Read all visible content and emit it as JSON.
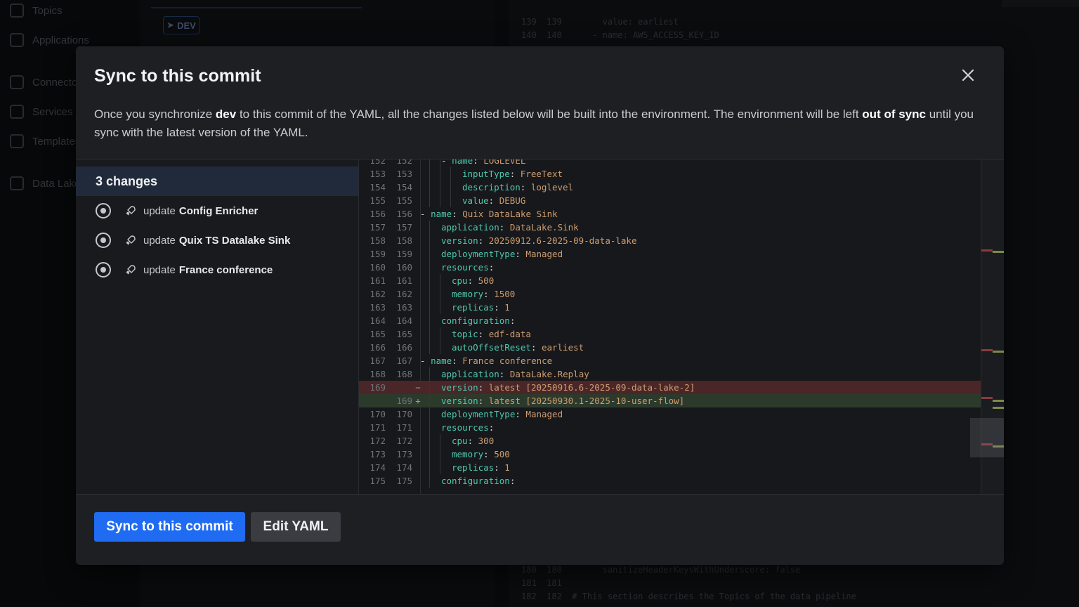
{
  "background": {
    "nav": [
      {
        "label": "Topics",
        "icon": "arrows-icon"
      },
      {
        "label": "Applications",
        "icon": "code-icon"
      },
      {
        "label": "Connectors",
        "icon": "plug-icon"
      },
      {
        "label": "Services",
        "icon": "cube-icon"
      },
      {
        "label": "Templates",
        "icon": "template-icon"
      },
      {
        "label": "Data Lake",
        "icon": "database-icon"
      }
    ],
    "dev_badge": "DEV",
    "code_rows": [
      "139  139        value: earliest",
      "140  140      - name: AWS_ACCESS_KEY_ID",
      "180  180        sanitizeHeaderKeysWithUnderscore: false",
      "181  181",
      "182  182  # This section describes the Topics of the data pipeline"
    ]
  },
  "modal": {
    "title": "Sync to this commit",
    "description": {
      "p1": "Once you synchronize ",
      "env": "dev",
      "p2": " to this commit of the YAML, all the changes listed below will be built into the environment. The environment will be left ",
      "status": "out of sync",
      "p3": " until you sync with the latest version of the YAML."
    },
    "changes_header": "3 changes",
    "changes": [
      {
        "prefix": "update",
        "name": "Config Enricher"
      },
      {
        "prefix": "update",
        "name": "Quix TS Datalake Sink"
      },
      {
        "prefix": "update",
        "name": "France conference"
      }
    ],
    "sync_button": "Sync to this commit",
    "edit_button": "Edit YAML"
  },
  "diff": [
    {
      "a": "152",
      "b": "152",
      "indent": 2,
      "dash": true,
      "key": "name",
      "val": "LOGLEVEL",
      "type": "ctx"
    },
    {
      "a": "153",
      "b": "153",
      "indent": 3,
      "key": "inputType",
      "val": "FreeText",
      "type": "ctx"
    },
    {
      "a": "154",
      "b": "154",
      "indent": 3,
      "key": "description",
      "val": "loglevel",
      "type": "ctx"
    },
    {
      "a": "155",
      "b": "155",
      "indent": 3,
      "key": "value",
      "val": "DEBUG",
      "type": "ctx"
    },
    {
      "a": "156",
      "b": "156",
      "indent": 0,
      "dash": true,
      "key": "name",
      "val": "Quix DataLake Sink",
      "type": "ctx"
    },
    {
      "a": "157",
      "b": "157",
      "indent": 1,
      "key": "application",
      "val": "DataLake.Sink",
      "type": "ctx"
    },
    {
      "a": "158",
      "b": "158",
      "indent": 1,
      "key": "version",
      "val": "20250912.6-2025-09-data-lake",
      "type": "ctx"
    },
    {
      "a": "159",
      "b": "159",
      "indent": 1,
      "key": "deploymentType",
      "val": "Managed",
      "type": "ctx"
    },
    {
      "a": "160",
      "b": "160",
      "indent": 1,
      "key": "resources",
      "val": "",
      "type": "ctx"
    },
    {
      "a": "161",
      "b": "161",
      "indent": 2,
      "key": "cpu",
      "val": "500",
      "type": "ctx"
    },
    {
      "a": "162",
      "b": "162",
      "indent": 2,
      "key": "memory",
      "val": "1500",
      "type": "ctx"
    },
    {
      "a": "163",
      "b": "163",
      "indent": 2,
      "key": "replicas",
      "val": "1",
      "type": "ctx"
    },
    {
      "a": "164",
      "b": "164",
      "indent": 1,
      "key": "configuration",
      "val": "",
      "type": "ctx"
    },
    {
      "a": "165",
      "b": "165",
      "indent": 2,
      "key": "topic",
      "val": "edf-data",
      "type": "ctx"
    },
    {
      "a": "166",
      "b": "166",
      "indent": 2,
      "key": "autoOffsetReset",
      "val": "earliest",
      "type": "ctx"
    },
    {
      "a": "167",
      "b": "167",
      "indent": 0,
      "dash": true,
      "key": "name",
      "val": "France conference",
      "type": "ctx"
    },
    {
      "a": "168",
      "b": "168",
      "indent": 1,
      "key": "application",
      "val": "DataLake.Replay",
      "type": "ctx"
    },
    {
      "a": "169",
      "b": "",
      "indent": 1,
      "key": "version",
      "val": "latest [20250916.6-2025-09-data-lake-2]",
      "type": "del"
    },
    {
      "a": "",
      "b": "169",
      "indent": 1,
      "key": "version",
      "val": "latest [20250930.1-2025-10-user-flow]",
      "type": "add"
    },
    {
      "a": "170",
      "b": "170",
      "indent": 1,
      "key": "deploymentType",
      "val": "Managed",
      "type": "ctx"
    },
    {
      "a": "171",
      "b": "171",
      "indent": 1,
      "key": "resources",
      "val": "",
      "type": "ctx"
    },
    {
      "a": "172",
      "b": "172",
      "indent": 2,
      "key": "cpu",
      "val": "300",
      "type": "ctx"
    },
    {
      "a": "173",
      "b": "173",
      "indent": 2,
      "key": "memory",
      "val": "500",
      "type": "ctx"
    },
    {
      "a": "174",
      "b": "174",
      "indent": 2,
      "key": "replicas",
      "val": "1",
      "type": "ctx"
    },
    {
      "a": "175",
      "b": "175",
      "indent": 1,
      "key": "configuration",
      "val": "",
      "type": "ctx"
    }
  ],
  "colors": {
    "primary": "#1f6bf2",
    "deleted_line": "#4a2628",
    "added_line": "#2c3a2c",
    "yaml_key": "#4ec9b0",
    "yaml_value": "#ce9d70"
  }
}
